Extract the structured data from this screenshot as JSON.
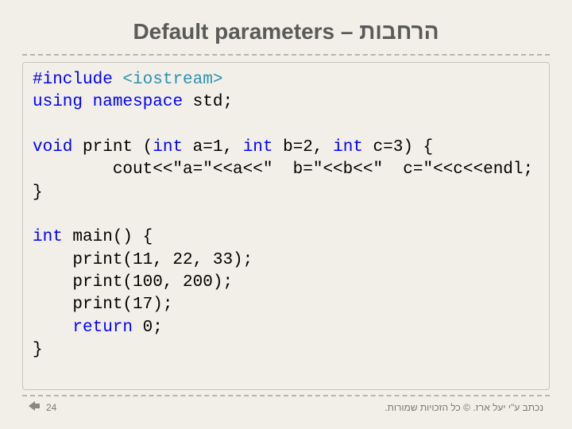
{
  "title_en": "Default parameters",
  "title_sep": " – ",
  "title_he": "הרחבות",
  "code": {
    "l1a": "#include",
    "l1b": " <iostream>",
    "l2a": "using",
    "l2b": " ",
    "l2c": "namespace",
    "l2d": " std;",
    "blank": "",
    "l3a": "void",
    "l3b": " print (",
    "l3c": "int",
    "l3d": " a=1, ",
    "l3e": "int",
    "l3f": " b=2, ",
    "l3g": "int",
    "l3h": " c=3) {",
    "l4": "        cout<<\"a=\"<<a<<\"  b=\"<<b<<\"  c=\"<<c<<endl;",
    "l5": "}",
    "l6a": "int",
    "l6b": " main() {",
    "l7": "    print(11, 22, 33);",
    "l8": "    print(100, 200);",
    "l9": "    print(17);",
    "l10a": "    ",
    "l10b": "return",
    "l10c": " 0;",
    "l11": "}"
  },
  "footer": {
    "page": "24",
    "credit": "נכתב ע\"י יעל ארז. © כל הזכויות שמורות."
  }
}
